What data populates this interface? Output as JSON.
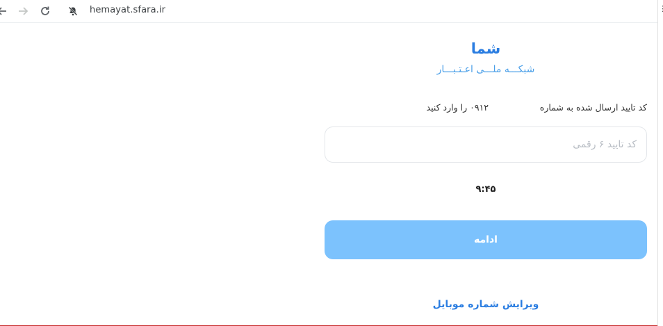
{
  "browser": {
    "url": "hemayat.sfara.ir",
    "icons": [
      "back-arrow-icon",
      "forward-arrow-icon",
      "reload-icon",
      "notifications-blocked-icon"
    ]
  },
  "brand": {
    "title": "شما",
    "subtitle": "شبکـــه ملـــی اعـتـبـــار"
  },
  "verification": {
    "instruction_part1": "کد تایید ارسال شده به شماره",
    "instruction_part2": "۰۹۱۲ را وارد کنید",
    "input_placeholder": "کد تایید ۶ رقمی",
    "timer": "۹:۴۵",
    "continue_label": "ادامه",
    "edit_mobile_label": "ویرایش شماره موبایل"
  },
  "colors": {
    "brand_blue": "#2a7de1",
    "button_blue": "#7cc2fd"
  }
}
